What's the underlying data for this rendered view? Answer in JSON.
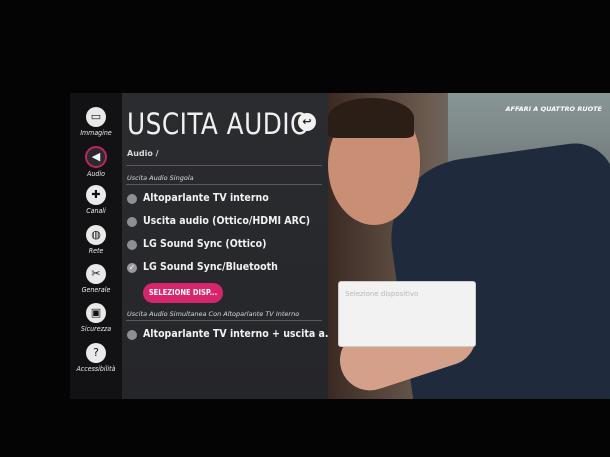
{
  "sidebar": {
    "items": [
      {
        "label": "Immagine",
        "icon": "picture-icon",
        "glyph": "▭"
      },
      {
        "label": "Audio",
        "icon": "speaker-icon",
        "glyph": "◀"
      },
      {
        "label": "Canali",
        "icon": "channels-icon",
        "glyph": "✚"
      },
      {
        "label": "Rete",
        "icon": "network-icon",
        "glyph": "◍"
      },
      {
        "label": "Generale",
        "icon": "general-icon",
        "glyph": "✂"
      },
      {
        "label": "Sicurezza",
        "icon": "lock-icon",
        "glyph": "▣"
      },
      {
        "label": "Accessibilità",
        "icon": "help-icon",
        "glyph": "?"
      }
    ],
    "active_index": 1
  },
  "panel": {
    "title": "USCITA AUDIO",
    "breadcrumb": "Audio /",
    "back_glyph": "↩",
    "single_section_label": "Uscita Audio Singola",
    "single_options": [
      {
        "label": "Altoparlante TV interno",
        "selected": false
      },
      {
        "label": "Uscita audio (Ottico/HDMI ARC)",
        "selected": false
      },
      {
        "label": "LG Sound Sync (Ottico)",
        "selected": false
      },
      {
        "label": "LG Sound Sync/Bluetooth",
        "selected": true
      }
    ],
    "select_device_button": "SELEZIONE DISP...",
    "simultaneous_section_label": "Uscita Audio Simultanea Con Altoparlante TV Interno",
    "simultaneous_options": [
      {
        "label": "Altoparlante TV interno + uscita a...",
        "selected": false
      }
    ],
    "check_glyph": "✓"
  },
  "video": {
    "show_title": "AFFARI A QUATTRO RUOTE",
    "search_placeholder": "Selezione dispositivo"
  },
  "colors": {
    "accent": "#d6256b",
    "sidebar_bg": "#121214",
    "panel_bg": "#2b2c30"
  }
}
